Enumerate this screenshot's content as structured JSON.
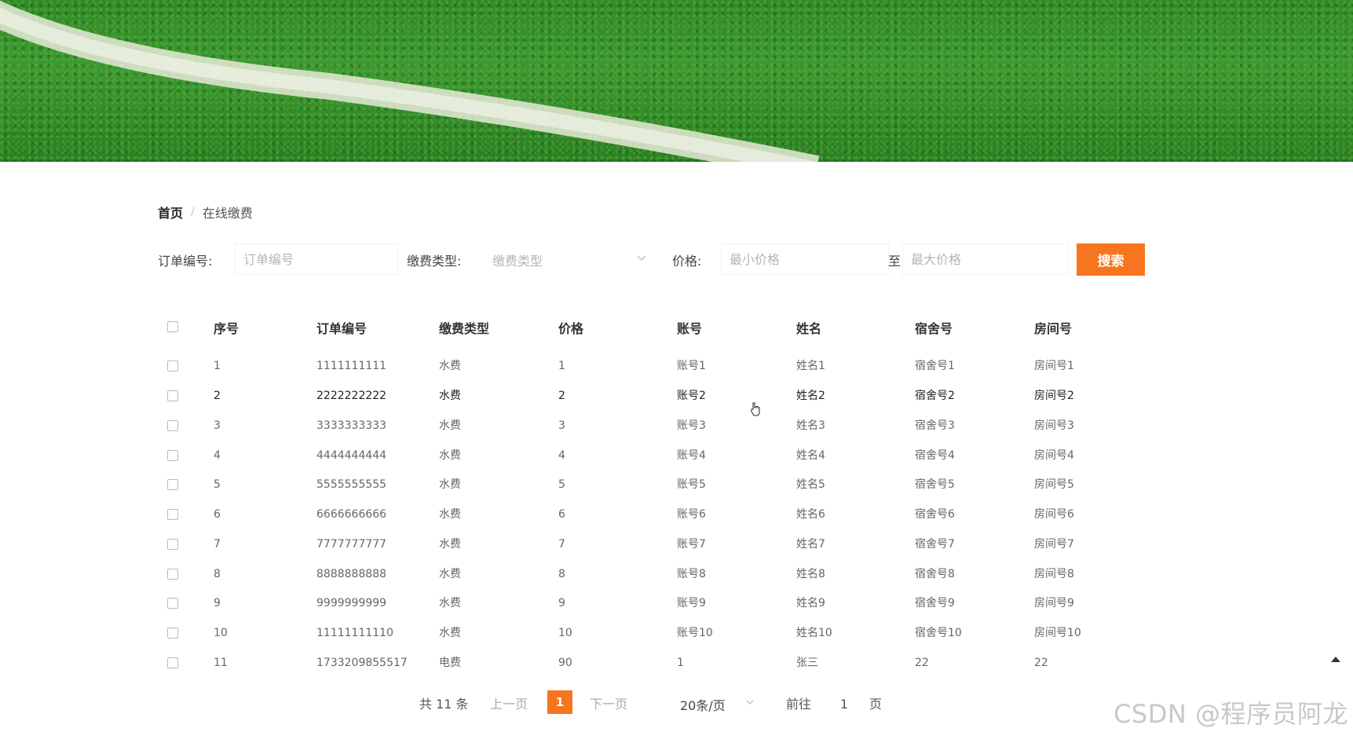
{
  "breadcrumb": {
    "home": "首页",
    "separator": "/",
    "current": "在线缴费"
  },
  "search": {
    "order_label": "订单编号:",
    "order_placeholder": "订单编号",
    "type_label": "缴费类型:",
    "type_placeholder": "缴费类型",
    "price_label": "价格:",
    "min_placeholder": "最小价格",
    "to_label": "至",
    "max_placeholder": "最大价格",
    "button": "搜索"
  },
  "table": {
    "headers": [
      "序号",
      "订单编号",
      "缴费类型",
      "价格",
      "账号",
      "姓名",
      "宿舍号",
      "房间号"
    ],
    "rows": [
      [
        "1",
        "1111111111",
        "水费",
        "1",
        "账号1",
        "姓名1",
        "宿舍号1",
        "房间号1"
      ],
      [
        "2",
        "2222222222",
        "水费",
        "2",
        "账号2",
        "姓名2",
        "宿舍号2",
        "房间号2"
      ],
      [
        "3",
        "3333333333",
        "水费",
        "3",
        "账号3",
        "姓名3",
        "宿舍号3",
        "房间号3"
      ],
      [
        "4",
        "4444444444",
        "水费",
        "4",
        "账号4",
        "姓名4",
        "宿舍号4",
        "房间号4"
      ],
      [
        "5",
        "5555555555",
        "水费",
        "5",
        "账号5",
        "姓名5",
        "宿舍号5",
        "房间号5"
      ],
      [
        "6",
        "6666666666",
        "水费",
        "6",
        "账号6",
        "姓名6",
        "宿舍号6",
        "房间号6"
      ],
      [
        "7",
        "7777777777",
        "水费",
        "7",
        "账号7",
        "姓名7",
        "宿舍号7",
        "房间号7"
      ],
      [
        "8",
        "8888888888",
        "水费",
        "8",
        "账号8",
        "姓名8",
        "宿舍号8",
        "房间号8"
      ],
      [
        "9",
        "9999999999",
        "水费",
        "9",
        "账号9",
        "姓名9",
        "宿舍号9",
        "房间号9"
      ],
      [
        "10",
        "11111111110",
        "水费",
        "10",
        "账号10",
        "姓名10",
        "宿舍号10",
        "房间号10"
      ],
      [
        "11",
        "1733209855517",
        "电费",
        "90",
        "1",
        "张三",
        "22",
        "22"
      ]
    ]
  },
  "pagination": {
    "total": "共 11 条",
    "prev": "上一页",
    "current_page": "1",
    "next": "下一页",
    "page_size": "20条/页",
    "goto_label": "前往",
    "goto_value": "1",
    "page_suffix": "页"
  },
  "watermark": "CSDN @程序员阿龙",
  "colors": {
    "accent": "#f7751f",
    "grass": "#3d9a33"
  },
  "icons": [
    "chevron-down-icon",
    "pointer-cursor-icon",
    "back-to-top-icon"
  ]
}
